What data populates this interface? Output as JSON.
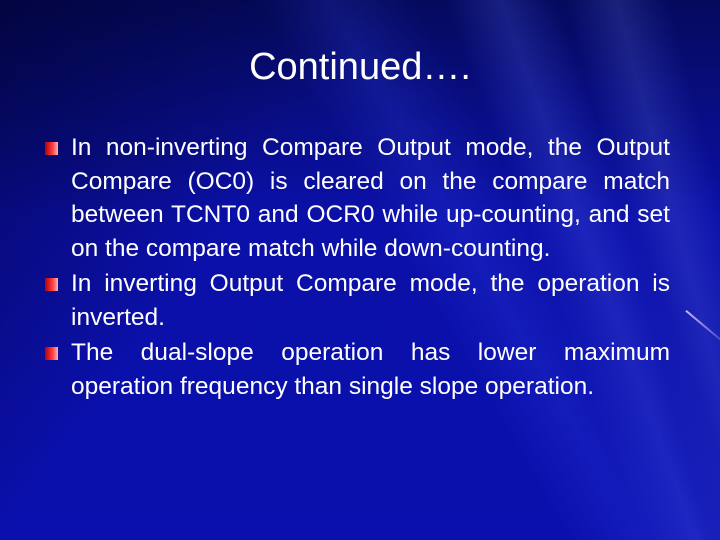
{
  "slide": {
    "title": "Continued….",
    "bullets": [
      {
        "icon": "red-square-bullet",
        "text": "In non-inverting Compare Output mode, the Output Compare (OC0) is cleared on the compare match between TCNT0 and OCR0 while up-counting, and set on the compare match while down-counting."
      },
      {
        "icon": "red-square-bullet",
        "text": "In inverting Output Compare mode, the operation is inverted."
      },
      {
        "icon": "red-square-bullet",
        "text": "The dual-slope operation has lower maximum operation frequency than single slope operation."
      }
    ],
    "colors": {
      "background": "#0a10ad",
      "text": "#ffffff",
      "bullet": "#e8202a"
    }
  }
}
